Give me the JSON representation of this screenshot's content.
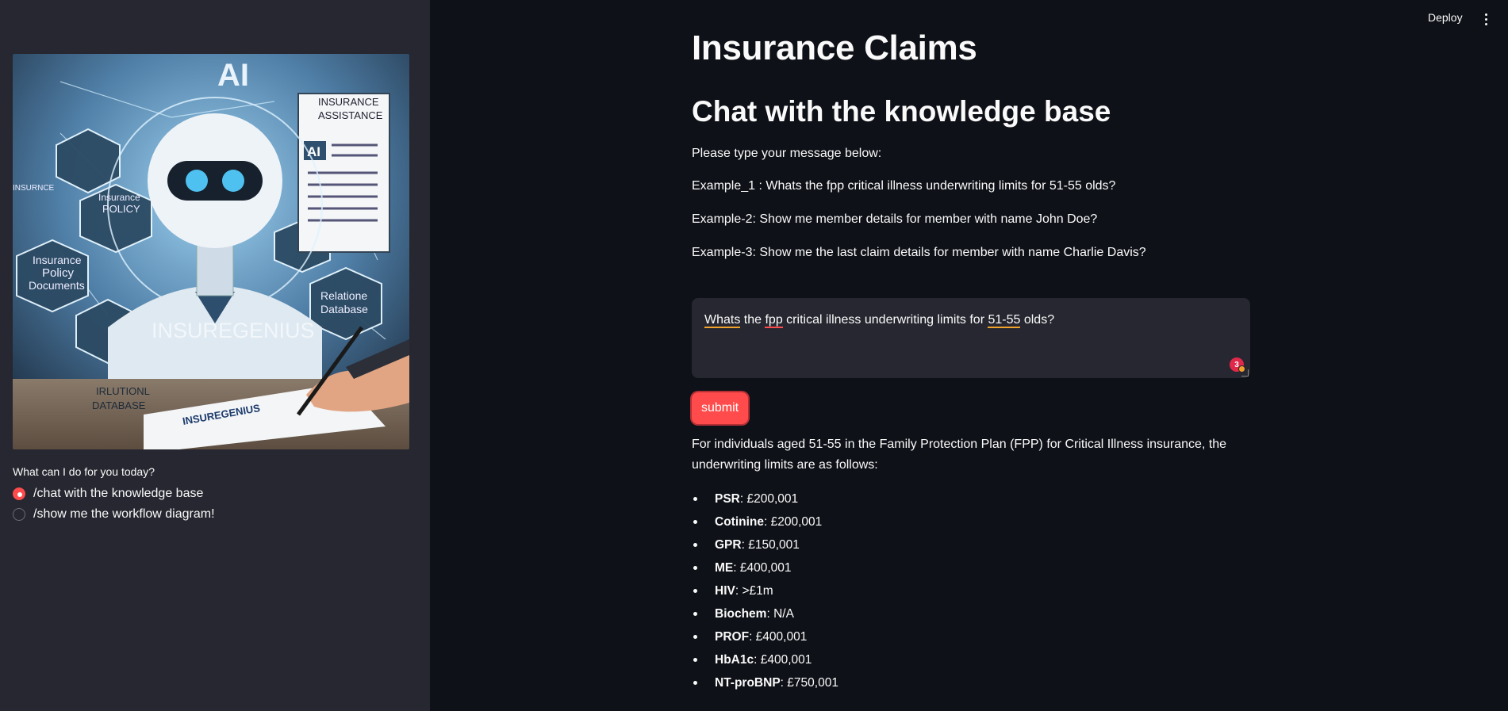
{
  "header": {
    "deploy_label": "Deploy"
  },
  "sidebar": {
    "hero_image": {
      "text_ai": "AI",
      "text_insurance_assistance_1": "INSURANCE",
      "text_insurance_assistance_2": "ASSISTANCE",
      "text_ai_badge": "AI",
      "text_insurance_policy_1": "Insurance",
      "text_insurance_policy_2": "POLICY",
      "text_policy_docs_1": "Insurance",
      "text_policy_docs_2": "Policy",
      "text_policy_docs_3": "Documents",
      "text_relational_1": "Relatione",
      "text_relational_2": "Database",
      "text_brand": "INSUREGENIUS",
      "text_irlutionl_1": "IRLUTIONL",
      "text_irlutionl_2": "DATABASE",
      "text_paper": "INSUREGENIUS",
      "text_insurance_small": "INSURNCE"
    },
    "radio_title": "What can I do for you today?",
    "options": [
      {
        "label": "/chat with the knowledge base",
        "selected": true
      },
      {
        "label": "/show me the workflow diagram!",
        "selected": false
      }
    ]
  },
  "main": {
    "title": "Insurance Claims",
    "subtitle": "Chat with the knowledge base",
    "intro": "Please type your message below:",
    "examples": [
      "Example_1 : Whats the fpp critical illness underwriting limits for 51-55 olds?",
      "Example-2: Show me member details for member with name John Doe?",
      "Example-3: Show me the last claim details for member with name Charlie Davis?"
    ],
    "input": {
      "w1": "Whats",
      "w2": " the ",
      "w3": "fpp",
      "w4": " critical illness underwriting limits for ",
      "w5": "51-55",
      "w6": " olds?",
      "badge_count": "3"
    },
    "submit_label": "submit",
    "answer": "For individuals aged 51-55 in the Family Protection Plan (FPP) for Critical Illness insurance, the underwriting limits are as follows:",
    "limits": [
      {
        "key": "PSR",
        "value": ": £200,001"
      },
      {
        "key": "Cotinine",
        "value": ": £200,001"
      },
      {
        "key": "GPR",
        "value": ": £150,001"
      },
      {
        "key": "ME",
        "value": ": £400,001"
      },
      {
        "key": "HIV",
        "value": ": >£1m"
      },
      {
        "key": "Biochem",
        "value": ": N/A"
      },
      {
        "key": "PROF",
        "value": ": £400,001"
      },
      {
        "key": "HbA1c",
        "value": ": £400,001"
      },
      {
        "key": "NT-proBNP",
        "value": ": £750,001"
      }
    ]
  }
}
